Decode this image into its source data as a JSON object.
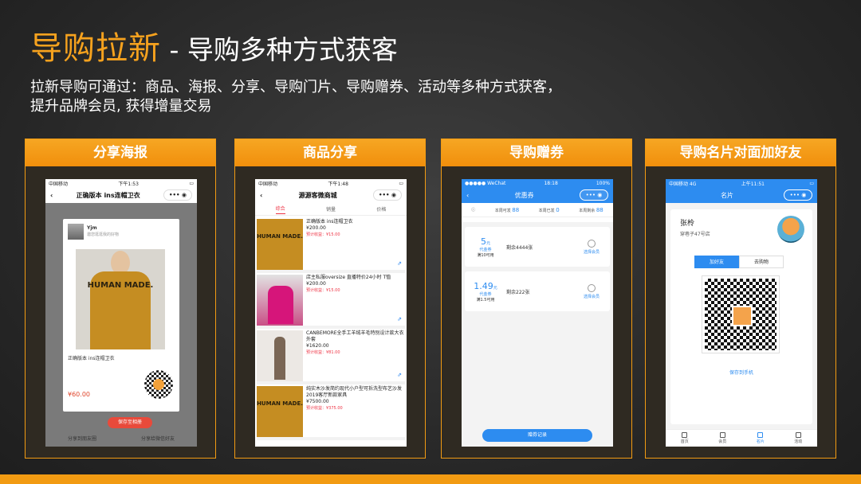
{
  "slide": {
    "title_highlight": "导购拉新",
    "title_rest": " - 导购多种方式获客",
    "description_line1": "拉新导购可通过：商品、海报、分享、导购门片、导购赠券、活动等多种方式获客，",
    "description_line2": "提升品牌会员, 获得增量交易"
  },
  "colors": {
    "accent": "#f29b12",
    "brand_blue": "#2d8cf0",
    "price_red": "#e0462c"
  },
  "panels": [
    {
      "header": "分享海报"
    },
    {
      "header": "商品分享"
    },
    {
      "header": "导购赠券"
    },
    {
      "header": "导购名片对面加好友"
    }
  ],
  "phone1": {
    "carrier": "中国移动",
    "time": "下午1:53",
    "nav_title": "正确版本 ins连帽卫衣",
    "user_name": "Yjm",
    "user_sub": "邀您逛逛我的好物",
    "sweater_text": "HUMAN MADE.",
    "product_title": "正确版本 ins连帽卫衣",
    "price": "¥60.00",
    "save_button": "保存至相册",
    "foot_left": "分享到朋友圈",
    "foot_right": "分享给微信好友"
  },
  "phone2": {
    "carrier": "中国移动",
    "time": "下午1:48",
    "nav_title": "源源客微商城",
    "tabs": [
      "综合",
      "销量",
      "价格"
    ],
    "products": [
      {
        "title": "正确版本 ins连帽卫衣",
        "price": "¥200.00",
        "earn": "预计收益：¥15.00",
        "img_text": "HUMAN MADE."
      },
      {
        "title": "店主私服oversize 直播特价24小时 T恤",
        "price": "¥200.00",
        "earn": "预计收益：¥15.00",
        "img_text": ""
      },
      {
        "title": "CANBEMORE全手工羊绒羊毛特别设计款大衣外套",
        "price": "¥1620.00",
        "earn": "预计收益：¥81.00",
        "img_text": ""
      },
      {
        "title": "纯实木沙发简约现代小户型可拆洗型布艺沙发2019客厅新款家具",
        "price": "¥7500.00",
        "earn": "预计收益：¥375.00",
        "img_text": "HUMAN MADE."
      }
    ]
  },
  "phone3": {
    "carrier": "●●●●● WeChat",
    "time": "18:18",
    "battery": "100%",
    "nav_title": "优惠券",
    "stats": [
      {
        "label": "本周可发",
        "value": "88"
      },
      {
        "label": "本周已发",
        "value": "0"
      },
      {
        "label": "本周剩余",
        "value": "88"
      }
    ],
    "coupons": [
      {
        "amount": "5",
        "unit": "元",
        "type": "代金券",
        "cond": "满10可用",
        "remain": "剩余4444张",
        "action": "选择会员"
      },
      {
        "amount": "1.49",
        "unit": "元",
        "type": "代金券",
        "cond": "满1.5可用",
        "remain": "剩余222张",
        "action": "选择会员"
      }
    ],
    "record_button": "赠券记录"
  },
  "phone4": {
    "carrier": "中国移动 4G",
    "time": "上午11:51",
    "nav_title": "名片",
    "name": "张柃",
    "address": "穿巷子47号店",
    "add_friend": "加好友",
    "shop": "去购物",
    "save_phone": "保存到手机",
    "tabbar": [
      "首页",
      "会员",
      "名片",
      "活动"
    ]
  }
}
